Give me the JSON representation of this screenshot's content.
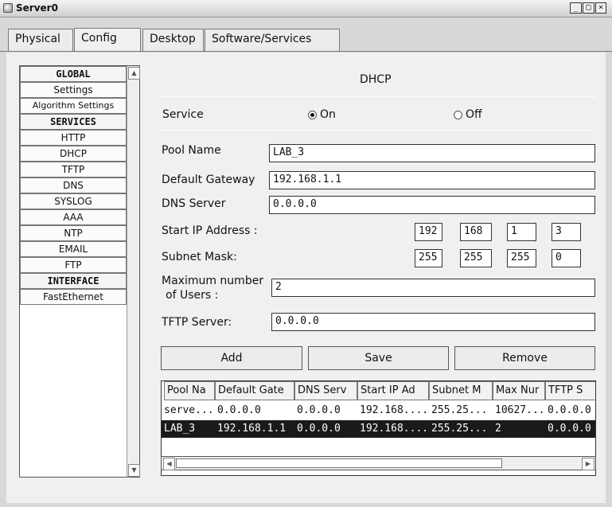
{
  "window": {
    "title": "Server0",
    "controls": [
      "_",
      "□",
      "×"
    ]
  },
  "tabs": [
    {
      "label": "Physical"
    },
    {
      "label": "Config"
    },
    {
      "label": "Desktop"
    },
    {
      "label": "Software/Services"
    }
  ],
  "active_tab": "Config",
  "sidebar": {
    "items": [
      {
        "label": "GLOBAL",
        "header": true
      },
      {
        "label": "Settings"
      },
      {
        "label": "Algorithm Settings"
      },
      {
        "label": "SERVICES",
        "header": true
      },
      {
        "label": "HTTP"
      },
      {
        "label": "DHCP"
      },
      {
        "label": "TFTP"
      },
      {
        "label": "DNS"
      },
      {
        "label": "SYSLOG"
      },
      {
        "label": "AAA"
      },
      {
        "label": "NTP"
      },
      {
        "label": "EMAIL"
      },
      {
        "label": "FTP"
      },
      {
        "label": "INTERFACE",
        "header": true
      },
      {
        "label": "FastEthernet"
      }
    ]
  },
  "dhcp": {
    "title": "DHCP",
    "service_label": "Service",
    "on_label": "On",
    "off_label": "Off",
    "service_selected": "On",
    "pool_name_label": "Pool Name",
    "pool_name": "LAB_3",
    "default_gateway_label": "Default Gateway",
    "default_gateway": "192.168.1.1",
    "dns_server_label": "DNS Server",
    "dns_server": "0.0.0.0",
    "start_ip_label": "Start IP Address :",
    "start_ip": [
      "192",
      "168",
      "1",
      "3"
    ],
    "subnet_mask_label": "Subnet Mask:",
    "subnet_mask": [
      "255",
      "255",
      "255",
      "0"
    ],
    "max_users_label_1": "Maximum number",
    "max_users_label_2": "of Users :",
    "max_users": "2",
    "tftp_server_label": "TFTP Server:",
    "tftp_server": "0.0.0.0",
    "buttons": {
      "add": "Add",
      "save": "Save",
      "remove": "Remove"
    }
  },
  "pool_table": {
    "columns": [
      "Pool Na",
      "Default Gate",
      "DNS Serv",
      "Start IP Ad",
      "Subnet M",
      "Max Nur",
      "TFTP S"
    ],
    "rows": [
      [
        "serve...",
        "0.0.0.0",
        "0.0.0.0",
        "192.168....",
        "255.25...",
        "10627...",
        "0.0.0.0"
      ],
      [
        "LAB_3",
        "192.168.1.1",
        "0.0.0.0",
        "192.168....",
        "255.25...",
        "2",
        "0.0.0.0"
      ]
    ],
    "selected_row": 1
  }
}
